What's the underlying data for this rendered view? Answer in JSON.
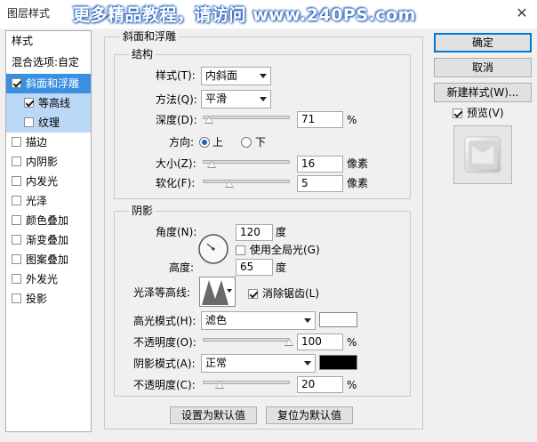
{
  "window": {
    "title": "图层样式",
    "watermark": "更多精品教程，请访问 www.240PS.com"
  },
  "sidebar": {
    "header": "样式",
    "blend_options": "混合选项:自定",
    "items": [
      {
        "label": "斜面和浮雕",
        "checked": true
      },
      {
        "label": "等高线",
        "checked": true
      },
      {
        "label": "纹理",
        "checked": false
      },
      {
        "label": "描边",
        "checked": false
      },
      {
        "label": "内阴影",
        "checked": false
      },
      {
        "label": "内发光",
        "checked": false
      },
      {
        "label": "光泽",
        "checked": false
      },
      {
        "label": "颜色叠加",
        "checked": false
      },
      {
        "label": "渐变叠加",
        "checked": false
      },
      {
        "label": "图案叠加",
        "checked": false
      },
      {
        "label": "外发光",
        "checked": false
      },
      {
        "label": "投影",
        "checked": false
      }
    ]
  },
  "bevel": {
    "group_title": "斜面和浮雕",
    "structure_title": "结构",
    "style_label": "样式(T):",
    "style_value": "内斜面",
    "technique_label": "方法(Q):",
    "technique_value": "平滑",
    "depth_label": "深度(D):",
    "depth_value": "71",
    "depth_unit": "%",
    "direction_label": "方向:",
    "direction_up": "上",
    "direction_down": "下",
    "size_label": "大小(Z):",
    "size_value": "16",
    "size_unit": "像素",
    "soften_label": "软化(F):",
    "soften_value": "5",
    "soften_unit": "像素"
  },
  "shading": {
    "title": "阴影",
    "angle_label": "角度(N):",
    "angle_value": "120",
    "angle_unit": "度",
    "global_light_label": "使用全局光(G)",
    "global_light_checked": false,
    "altitude_label": "高度:",
    "altitude_value": "65",
    "altitude_unit": "度",
    "gloss_label": "光泽等高线:",
    "antialias_label": "消除锯齿(L)",
    "antialias_checked": true,
    "highlight_mode_label": "高光模式(H):",
    "highlight_mode_value": "滤色",
    "highlight_color": "#ffffff",
    "highlight_opacity_label": "不透明度(O):",
    "highlight_opacity_value": "100",
    "highlight_opacity_unit": "%",
    "shadow_mode_label": "阴影模式(A):",
    "shadow_mode_value": "正常",
    "shadow_color": "#000000",
    "shadow_opacity_label": "不透明度(C):",
    "shadow_opacity_value": "20",
    "shadow_opacity_unit": "%"
  },
  "footer": {
    "set_default": "设置为默认值",
    "reset_default": "复位为默认值"
  },
  "actions": {
    "ok": "确定",
    "cancel": "取消",
    "new_style": "新建样式(W)...",
    "preview_label": "预览(V)",
    "preview_checked": true
  }
}
